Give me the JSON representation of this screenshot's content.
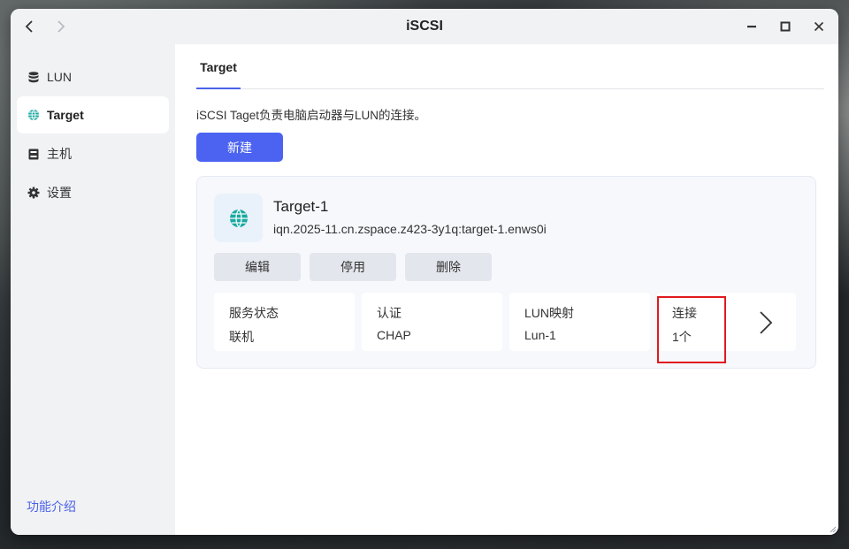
{
  "window": {
    "title": "iSCSI",
    "icons": {
      "back": "chevron-left-icon",
      "forward": "chevron-right-icon",
      "minimize": "minimize-icon",
      "maximize": "maximize-icon",
      "close": "close-icon"
    }
  },
  "sidebar": {
    "items": [
      {
        "label": "LUN",
        "icon": "database-icon",
        "active": false
      },
      {
        "label": "Target",
        "icon": "globe-icon",
        "active": true
      },
      {
        "label": "主机",
        "icon": "server-icon",
        "active": false
      },
      {
        "label": "设置",
        "icon": "gear-icon",
        "active": false
      }
    ],
    "footer_link": "功能介绍"
  },
  "main": {
    "tabs": [
      {
        "label": "Target",
        "active": true
      }
    ],
    "description": "iSCSI Taget负责电脑启动器与LUN的连接。",
    "new_button": "新建",
    "accent_color": "#4b63f0",
    "targets": [
      {
        "name": "Target-1",
        "iqn": "iqn.2025-11.cn.zspace.z423-3y1q:target-1.enws0i",
        "icon": "globe-icon",
        "actions": [
          "编辑",
          "停用",
          "删除"
        ],
        "info": [
          {
            "label": "服务状态",
            "value": "联机"
          },
          {
            "label": "认证",
            "value": "CHAP"
          },
          {
            "label": "LUN映射",
            "value": "Lun-1"
          },
          {
            "label": "连接",
            "value": "1个",
            "highlighted": true
          }
        ]
      }
    ]
  }
}
